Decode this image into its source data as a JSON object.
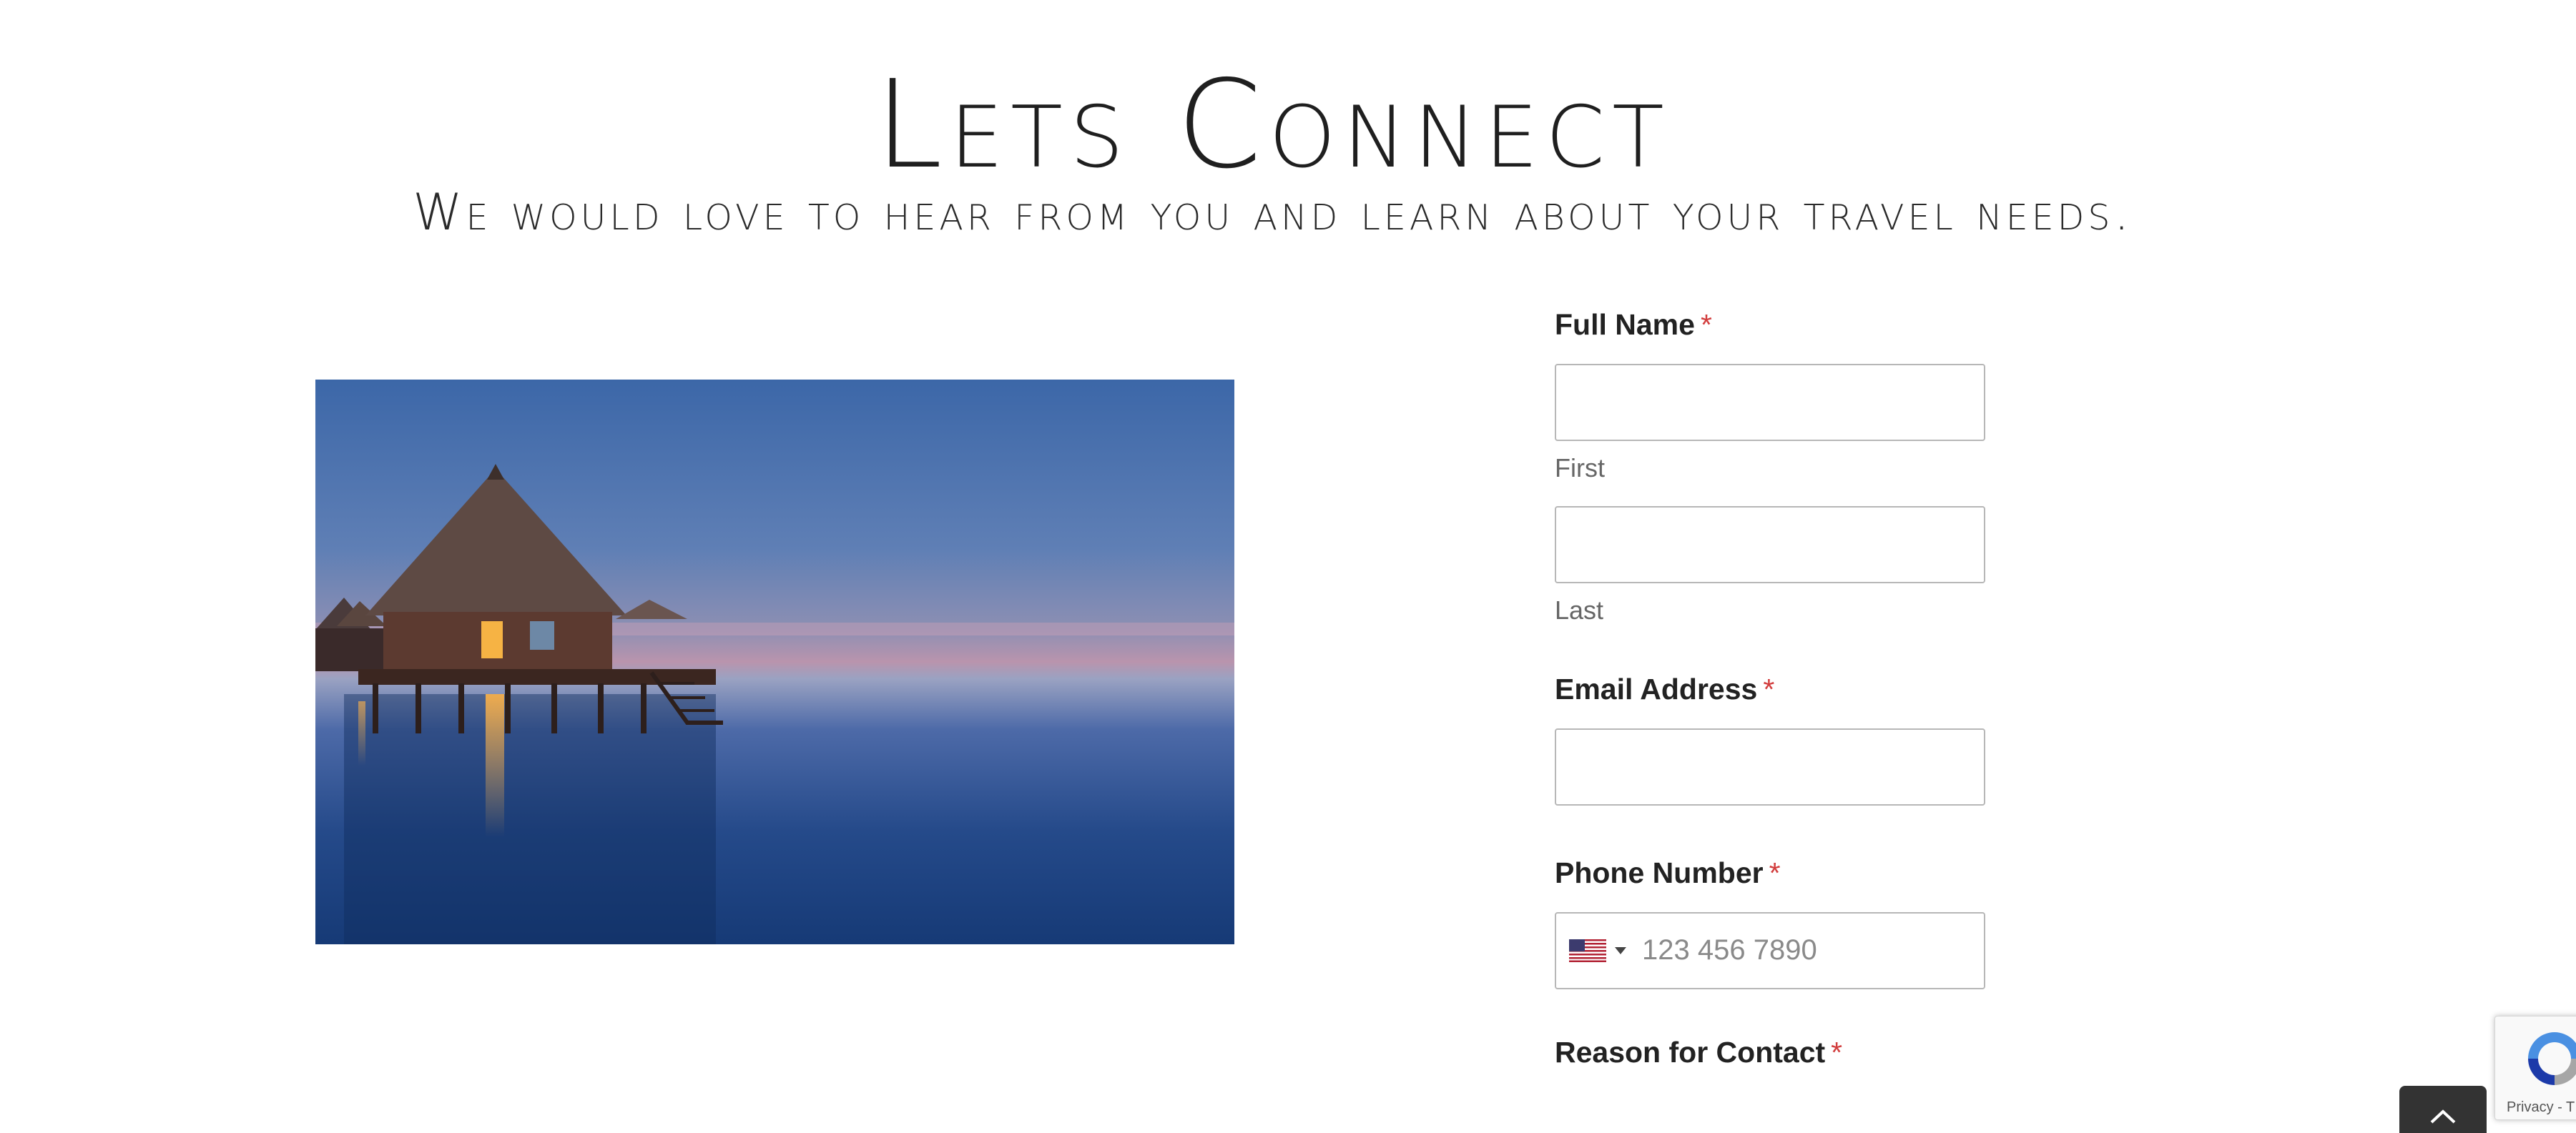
{
  "header": {
    "title": "Lets Connect",
    "subtitle": "We would love to hear from you and learn about your travel needs."
  },
  "photo": {
    "description": "overwater-bungalow-at-dusk"
  },
  "form": {
    "full_name": {
      "label": "Full Name",
      "required_marker": "*",
      "first_sublabel": "First",
      "last_sublabel": "Last",
      "first_value": "",
      "last_value": ""
    },
    "email": {
      "label": "Email Address",
      "required_marker": "*",
      "value": ""
    },
    "phone": {
      "label": "Phone Number",
      "required_marker": "*",
      "country_icon": "us-flag-icon",
      "placeholder": "123 456 7890",
      "value": ""
    },
    "reason": {
      "label": "Reason for Contact",
      "required_marker": "*"
    }
  },
  "recaptcha": {
    "text": "Privacy - T"
  },
  "icons": {
    "scroll_top": "chevron-up-icon",
    "recaptcha": "recaptcha-icon"
  },
  "colors": {
    "required": "#d23d3d",
    "input_border": "#b7b7b7",
    "scroll_top_bg": "#333333"
  }
}
